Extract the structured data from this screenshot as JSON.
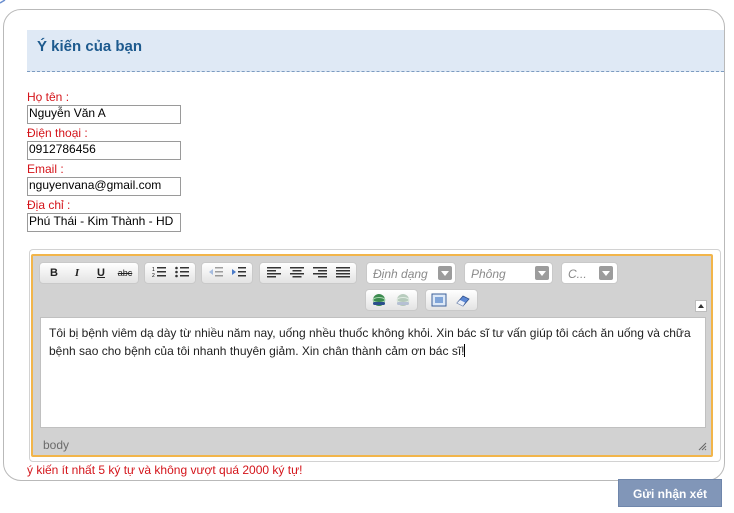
{
  "form": {
    "title": "Ý kiến của bạn",
    "fields": [
      {
        "label": "Họ tên :",
        "value": "Nguyễn Văn A"
      },
      {
        "label": "Điện thoại :",
        "value": "0912786456"
      },
      {
        "label": "Email :",
        "value": "nguyenvana@gmail.com"
      },
      {
        "label": "Địa chỉ :",
        "value": "Phú Thái - Kim Thành - HD"
      }
    ],
    "hint": "ý kiến ít nhất 5 ký tự và không vượt quá 2000 ký tự!",
    "submit_label": "Gửi nhận xét"
  },
  "editor": {
    "format_placeholder": "Định dạng",
    "font_placeholder": "Phông",
    "size_placeholder": "C...",
    "content": "Tôi bị bệnh viêm dạ dày từ nhiều năm nay, uống nhều thuốc không khỏi. Xin bác sĩ tư vấn giúp tôi cách ăn uống và chữa bệnh sao cho bệnh của tôi nhanh thuyên giảm. Xin chân thành cảm ơn bác sĩ!",
    "status_path": "body",
    "buttons": {
      "bold": "B",
      "italic": "I",
      "underline": "U",
      "strike": "abc"
    }
  },
  "colors": {
    "label": "#d4141a",
    "header_bg": "#dfe9f5",
    "title": "#1d5a8e",
    "editor_border": "#f2b54a",
    "submit_bg": "#8196b8"
  },
  "icons": [
    "ordered-list-icon",
    "bullet-list-icon",
    "outdent-icon",
    "indent-icon",
    "align-left-icon",
    "align-center-icon",
    "align-right-icon",
    "align-justify-icon",
    "link-icon",
    "unlink-icon",
    "select-all-icon",
    "eraser-icon",
    "collapse-toolbar-icon",
    "resize-handle-icon"
  ]
}
